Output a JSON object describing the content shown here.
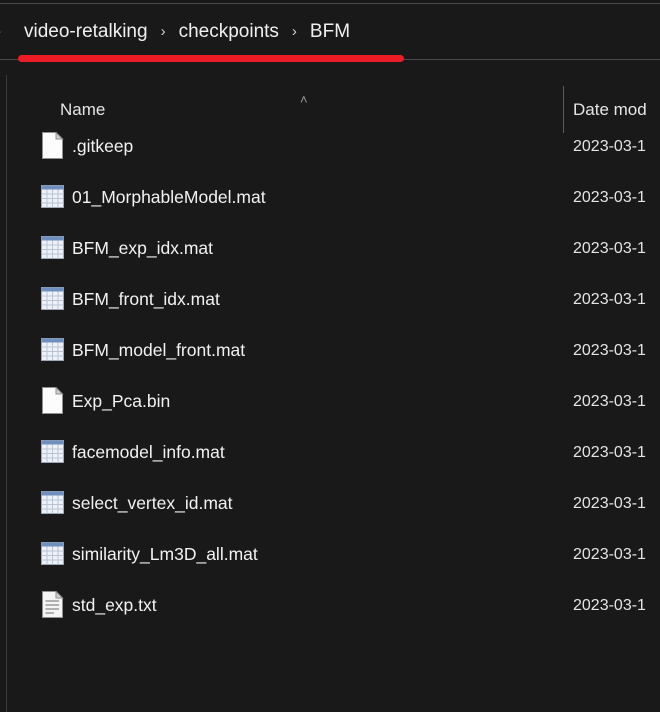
{
  "breadcrumb": {
    "leading_separator": "›",
    "separator": "›",
    "items": [
      {
        "label": "video-retalking"
      },
      {
        "label": "checkpoints"
      },
      {
        "label": "BFM"
      }
    ]
  },
  "annotation": {
    "type": "red-underline",
    "color": "#ed1c24"
  },
  "columns": {
    "name": "Name",
    "date_modified": "Date mod",
    "sort_indicator": "˄",
    "sort_direction": "ascending"
  },
  "files": [
    {
      "name": ".gitkeep",
      "icon": "blank-file-icon",
      "date": "2023-03-1"
    },
    {
      "name": "01_MorphableModel.mat",
      "icon": "spreadsheet-file-icon",
      "date": "2023-03-1"
    },
    {
      "name": "BFM_exp_idx.mat",
      "icon": "spreadsheet-file-icon",
      "date": "2023-03-1"
    },
    {
      "name": "BFM_front_idx.mat",
      "icon": "spreadsheet-file-icon",
      "date": "2023-03-1"
    },
    {
      "name": "BFM_model_front.mat",
      "icon": "spreadsheet-file-icon",
      "date": "2023-03-1"
    },
    {
      "name": "Exp_Pca.bin",
      "icon": "blank-file-icon",
      "date": "2023-03-1"
    },
    {
      "name": "facemodel_info.mat",
      "icon": "spreadsheet-file-icon",
      "date": "2023-03-1"
    },
    {
      "name": "select_vertex_id.mat",
      "icon": "spreadsheet-file-icon",
      "date": "2023-03-1"
    },
    {
      "name": "similarity_Lm3D_all.mat",
      "icon": "spreadsheet-file-icon",
      "date": "2023-03-1"
    },
    {
      "name": "std_exp.txt",
      "icon": "text-file-icon",
      "date": "2023-03-1"
    }
  ],
  "theme": {
    "background": "#191919",
    "text": "#f2f2f2",
    "divider": "#4a4a4a"
  }
}
